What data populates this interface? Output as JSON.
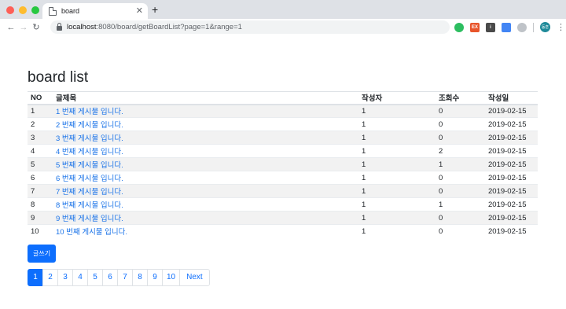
{
  "browser": {
    "tab_title": "board",
    "url_host": "localhost",
    "url_rest": ":8080/board/getBoardList?page=1&range=1",
    "extensions": [
      "evernote-icon",
      "extension-ex-icon",
      "extension-info-icon",
      "extension-blue-icon",
      "cloud-icon"
    ],
    "ext_labels": {
      "orange": "EX",
      "dark": "i"
    },
    "avatar_text": "동훈"
  },
  "board": {
    "title": "board list",
    "headers": {
      "no": "NO",
      "title": "글제목",
      "writer": "작성자",
      "views": "조회수",
      "date": "작성일"
    },
    "rows": [
      {
        "no": "1",
        "title": "1 번째 게시물 입니다.",
        "writer": "1",
        "views": "0",
        "date": "2019-02-15"
      },
      {
        "no": "2",
        "title": "2 번째 게시물 입니다.",
        "writer": "1",
        "views": "0",
        "date": "2019-02-15"
      },
      {
        "no": "3",
        "title": "3 번째 게시물 입니다.",
        "writer": "1",
        "views": "0",
        "date": "2019-02-15"
      },
      {
        "no": "4",
        "title": "4 번째 게시물 입니다.",
        "writer": "1",
        "views": "2",
        "date": "2019-02-15"
      },
      {
        "no": "5",
        "title": "5 번째 게시물 입니다.",
        "writer": "1",
        "views": "1",
        "date": "2019-02-15"
      },
      {
        "no": "6",
        "title": "6 번째 게시물 입니다.",
        "writer": "1",
        "views": "0",
        "date": "2019-02-15"
      },
      {
        "no": "7",
        "title": "7 번째 게시물 입니다.",
        "writer": "1",
        "views": "0",
        "date": "2019-02-15"
      },
      {
        "no": "8",
        "title": "8 번째 게시물 입니다.",
        "writer": "1",
        "views": "1",
        "date": "2019-02-15"
      },
      {
        "no": "9",
        "title": "9 번째 게시물 입니다.",
        "writer": "1",
        "views": "0",
        "date": "2019-02-15"
      },
      {
        "no": "10",
        "title": "10 번째 게시물 입니다.",
        "writer": "1",
        "views": "0",
        "date": "2019-02-15"
      }
    ],
    "write_button": "글쓰기",
    "pages": [
      "1",
      "2",
      "3",
      "4",
      "5",
      "6",
      "7",
      "8",
      "9",
      "10"
    ],
    "active_page": "1",
    "next_label": "Next"
  },
  "colors": {
    "primary": "#0d6efd",
    "link": "#1a73e8",
    "stripe": "#f2f2f2"
  }
}
